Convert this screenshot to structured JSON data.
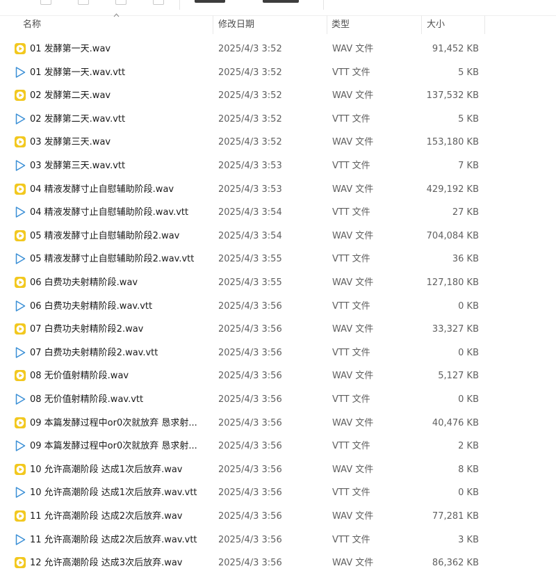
{
  "colors": {
    "wav_icon": "#F2C81F",
    "vtt_icon": "#3A8FD6",
    "header_text": "#4d4d4d",
    "cell_text": "#5f5f5f"
  },
  "columns": {
    "name": "名称",
    "date": "修改日期",
    "type": "类型",
    "size": "大小"
  },
  "sort": {
    "column": "name",
    "direction": "ascending"
  },
  "files": [
    {
      "name": "01 发酵第一天.wav",
      "date": "2025/4/3 3:52",
      "type": "WAV 文件",
      "size": "91,452 KB",
      "icon": "wav-audio-icon"
    },
    {
      "name": "01 发酵第一天.wav.vtt",
      "date": "2025/4/3 3:52",
      "type": "VTT 文件",
      "size": "5 KB",
      "icon": "vtt-media-icon"
    },
    {
      "name": "02 发酵第二天.wav",
      "date": "2025/4/3 3:52",
      "type": "WAV 文件",
      "size": "137,532 KB",
      "icon": "wav-audio-icon"
    },
    {
      "name": "02 发酵第二天.wav.vtt",
      "date": "2025/4/3 3:52",
      "type": "VTT 文件",
      "size": "5 KB",
      "icon": "vtt-media-icon"
    },
    {
      "name": "03 发酵第三天.wav",
      "date": "2025/4/3 3:52",
      "type": "WAV 文件",
      "size": "153,180 KB",
      "icon": "wav-audio-icon"
    },
    {
      "name": "03 发酵第三天.wav.vtt",
      "date": "2025/4/3 3:53",
      "type": "VTT 文件",
      "size": "7 KB",
      "icon": "vtt-media-icon"
    },
    {
      "name": "04 精液发酵寸止自慰辅助阶段.wav",
      "date": "2025/4/3 3:53",
      "type": "WAV 文件",
      "size": "429,192 KB",
      "icon": "wav-audio-icon"
    },
    {
      "name": "04 精液发酵寸止自慰辅助阶段.wav.vtt",
      "date": "2025/4/3 3:54",
      "type": "VTT 文件",
      "size": "27 KB",
      "icon": "vtt-media-icon"
    },
    {
      "name": "05 精液发酵寸止自慰辅助阶段2.wav",
      "date": "2025/4/3 3:54",
      "type": "WAV 文件",
      "size": "704,084 KB",
      "icon": "wav-audio-icon"
    },
    {
      "name": "05 精液发酵寸止自慰辅助阶段2.wav.vtt",
      "date": "2025/4/3 3:55",
      "type": "VTT 文件",
      "size": "36 KB",
      "icon": "vtt-media-icon"
    },
    {
      "name": "06 白费功夫射精阶段.wav",
      "date": "2025/4/3 3:55",
      "type": "WAV 文件",
      "size": "127,180 KB",
      "icon": "wav-audio-icon"
    },
    {
      "name": "06 白费功夫射精阶段.wav.vtt",
      "date": "2025/4/3 3:56",
      "type": "VTT 文件",
      "size": "0 KB",
      "icon": "vtt-media-icon"
    },
    {
      "name": "07 白费功夫射精阶段2.wav",
      "date": "2025/4/3 3:56",
      "type": "WAV 文件",
      "size": "33,327 KB",
      "icon": "wav-audio-icon"
    },
    {
      "name": "07 白费功夫射精阶段2.wav.vtt",
      "date": "2025/4/3 3:56",
      "type": "VTT 文件",
      "size": "0 KB",
      "icon": "vtt-media-icon"
    },
    {
      "name": "08 无价值射精阶段.wav",
      "date": "2025/4/3 3:56",
      "type": "WAV 文件",
      "size": "5,127 KB",
      "icon": "wav-audio-icon"
    },
    {
      "name": "08 无价值射精阶段.wav.vtt",
      "date": "2025/4/3 3:56",
      "type": "VTT 文件",
      "size": "0 KB",
      "icon": "vtt-media-icon"
    },
    {
      "name": "09 本篇发酵过程中or0次就放弃 恳求射...",
      "date": "2025/4/3 3:56",
      "type": "WAV 文件",
      "size": "40,476 KB",
      "icon": "wav-audio-icon"
    },
    {
      "name": "09 本篇发酵过程中or0次就放弃 恳求射...",
      "date": "2025/4/3 3:56",
      "type": "VTT 文件",
      "size": "2 KB",
      "icon": "vtt-media-icon"
    },
    {
      "name": "10 允许高潮阶段 达成1次后放弃.wav",
      "date": "2025/4/3 3:56",
      "type": "WAV 文件",
      "size": "8 KB",
      "icon": "wav-audio-icon"
    },
    {
      "name": "10 允许高潮阶段 达成1次后放弃.wav.vtt",
      "date": "2025/4/3 3:56",
      "type": "VTT 文件",
      "size": "0 KB",
      "icon": "vtt-media-icon"
    },
    {
      "name": "11 允许高潮阶段 达成2次后放弃.wav",
      "date": "2025/4/3 3:56",
      "type": "WAV 文件",
      "size": "77,281 KB",
      "icon": "wav-audio-icon"
    },
    {
      "name": "11 允许高潮阶段 达成2次后放弃.wav.vtt",
      "date": "2025/4/3 3:56",
      "type": "VTT 文件",
      "size": "3 KB",
      "icon": "vtt-media-icon"
    },
    {
      "name": "12 允许高潮阶段 达成3次后放弃.wav",
      "date": "2025/4/3 3:56",
      "type": "WAV 文件",
      "size": "86,362 KB",
      "icon": "wav-audio-icon"
    }
  ]
}
